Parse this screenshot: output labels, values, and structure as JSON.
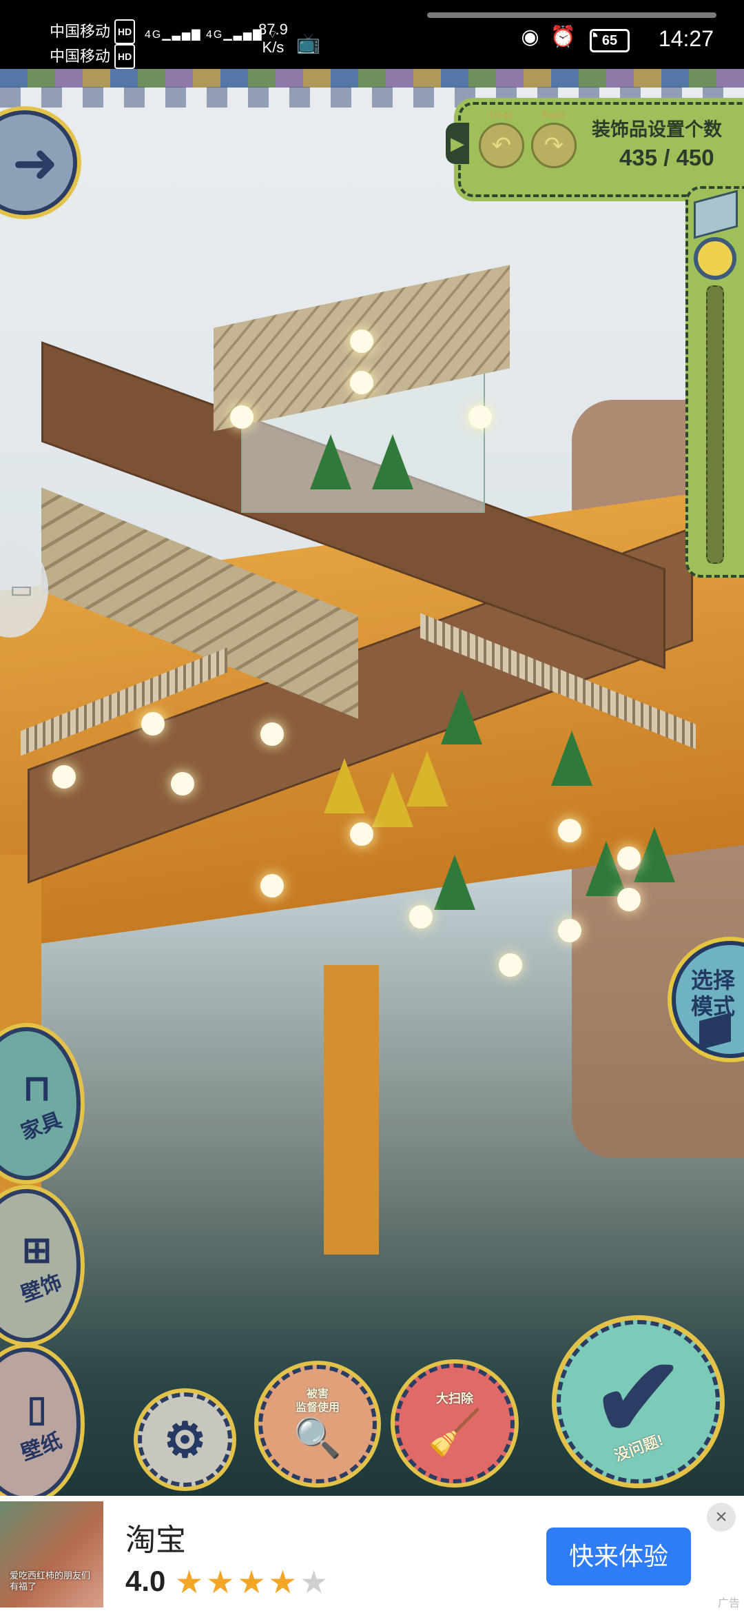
{
  "status_bar": {
    "carrier_1": "中国移动",
    "carrier_2": "中国移动",
    "hd_badge": "HD",
    "net_type": "4G",
    "speed_value": "87.9",
    "speed_unit": "K/s",
    "battery": "65",
    "time": "14:27"
  },
  "hud": {
    "undo_label": "Undo",
    "redo_label": "Redo",
    "decor_count_label": "装饰品设置个数",
    "decor_count_value": "435 / 450",
    "mode_label_line1": "选择",
    "mode_label_line2": "模式",
    "furniture_label": "家具",
    "decor_label": "壁饰",
    "wallpaper_label": "壁纸",
    "inspect_label_line1": "被害",
    "inspect_label_line2": "监督使用",
    "clean_label": "大扫除",
    "confirm_label": "没问题!"
  },
  "ad": {
    "thumb_caption": "爱吃西红柿的朋友们有福了",
    "title": "淘宝",
    "rating": "4.0",
    "stars_filled": 4,
    "stars_total": 5,
    "cta": "快来体验",
    "tag": "广告"
  }
}
